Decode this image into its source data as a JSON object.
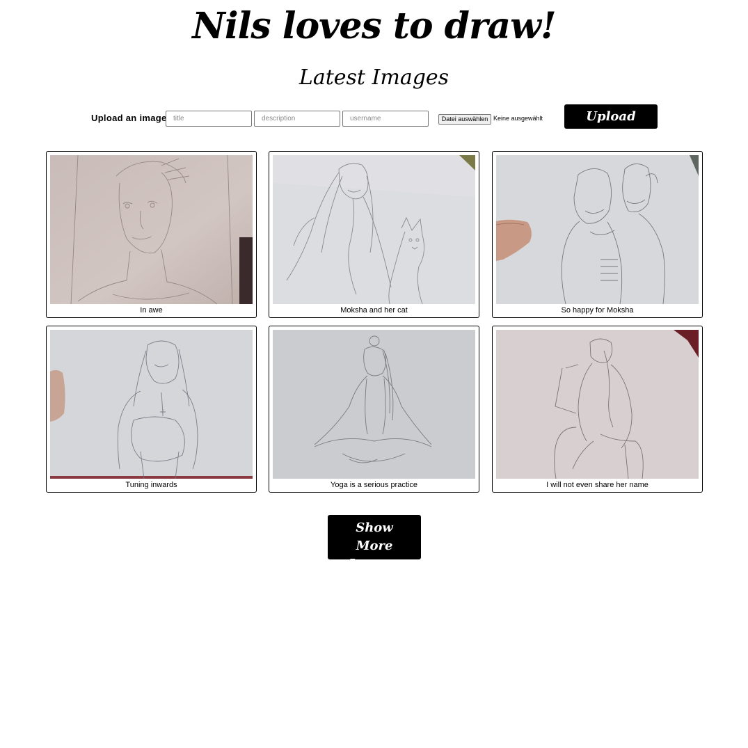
{
  "header": {
    "site_title": "Nils loves to draw!",
    "section_title": "Latest Images"
  },
  "upload_form": {
    "label": "Upload an image:",
    "title_placeholder": "title",
    "description_placeholder": "description",
    "username_placeholder": "username",
    "file_button_label": "Datei auswählen",
    "file_status": "Keine ausgewählt",
    "upload_label": "Upload"
  },
  "gallery": {
    "images": [
      {
        "caption": "In awe",
        "subject": "pencil-portrait-face"
      },
      {
        "caption": "Moksha and her cat",
        "subject": "pencil-woman-with-cat"
      },
      {
        "caption": "So happy for Moksha",
        "subject": "pencil-couple-portrait"
      },
      {
        "caption": "Tuning inwards",
        "subject": "pencil-seated-woman-hugging-knees"
      },
      {
        "caption": "Yoga is a serious practice",
        "subject": "pencil-cross-legged-yoga-figure"
      },
      {
        "caption": "I will not even share her name",
        "subject": "pencil-seated-figure-from-behind"
      }
    ]
  },
  "show_more": {
    "label": "Show More Images"
  },
  "colors": {
    "button_background": "#000000",
    "button_text": "#ffffff",
    "page_background": "#ffffff"
  }
}
